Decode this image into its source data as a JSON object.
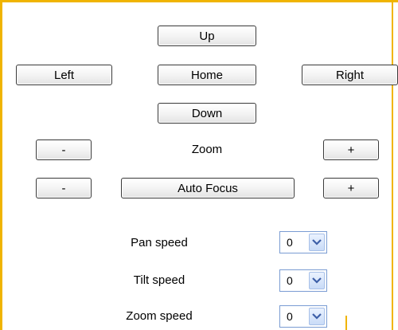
{
  "controls": {
    "up": "Up",
    "left": "Left",
    "home": "Home",
    "right": "Right",
    "down": "Down",
    "zoom_label": "Zoom",
    "zoom_minus": "-",
    "zoom_plus": "+",
    "focus_minus": "-",
    "focus_auto": "Auto Focus",
    "focus_plus": "+"
  },
  "speeds": [
    {
      "label": "Pan speed",
      "value": "0"
    },
    {
      "label": "Tilt speed",
      "value": "0"
    },
    {
      "label": "Zoom speed",
      "value": "0"
    }
  ],
  "colors": {
    "frame": "#f0b400",
    "select_border": "#7a9cd3"
  },
  "icons": {
    "dropdown": "chevron-down-icon"
  }
}
